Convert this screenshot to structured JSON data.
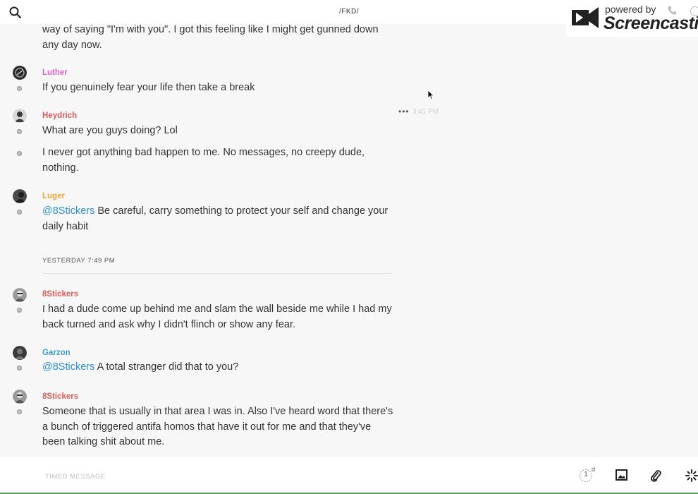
{
  "header": {
    "channel_title": "/FKD/"
  },
  "watermark": {
    "powered": "powered by",
    "brand": "Screencastify"
  },
  "messages": {
    "cont_text": "way of saying \"I'm with you\". I got this feeling like I might get gunned down any day now.",
    "luther": {
      "author": "Luther",
      "color": "#d966c4",
      "text": "If you genuinely fear your life then take a break",
      "time": "3:41 PM"
    },
    "heydrich": {
      "author": "Heydrich",
      "color": "#e05a5a",
      "text1": "What are you guys doing? Lol",
      "text2": "I never got anything bad happen to me. No messages, no creepy dude, nothing."
    },
    "luger": {
      "author": "Luger",
      "color": "#e8a33c",
      "mention": "@8Stickers",
      "text": " Be careful, carry something to protect your self and change your daily habit"
    },
    "separator": "YESTERDAY 7:49 PM",
    "stickers1": {
      "author": "8Stickers",
      "color": "#e05a5a",
      "text": "I had a dude come up behind me and slam the wall beside me while I had my back turned and ask why I didn't flinch or show any fear."
    },
    "garzon": {
      "author": "Garzon",
      "color": "#3aa0cc",
      "mention": "@8Stickers",
      "text": " A total stranger did that to you?"
    },
    "stickers2": {
      "author": "8Stickers",
      "color": "#e05a5a",
      "text": "Someone that is usually in that area I was in. Also I've heard word that there's a bunch of triggered antifa homos that have it out for me and that they've been talking shit about me."
    }
  },
  "composer": {
    "placeholder": "TIMED MESSAGE",
    "timer_count": "1",
    "timer_unit": "d",
    "icons": [
      "timer-icon",
      "image-icon",
      "paperclip-icon",
      "sparkle-icon"
    ]
  },
  "colors": {
    "mention": "#2f8fd3",
    "status_bar": "#5a9a5a"
  }
}
